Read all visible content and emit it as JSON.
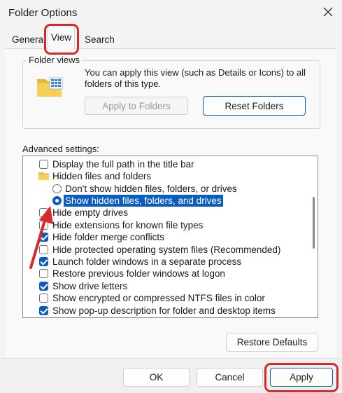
{
  "window": {
    "title": "Folder Options",
    "close_icon": "close-icon"
  },
  "tabs": [
    {
      "label": "General"
    },
    {
      "label": "View"
    },
    {
      "label": "Search"
    }
  ],
  "folder_views": {
    "group_label": "Folder views",
    "folder_icon": "folder-icon",
    "description_line1": "You can apply this view (such as Details or Icons) to all",
    "description_line2": "folders of this type.",
    "apply_to_folders_label": "Apply to Folders",
    "reset_folders_label": "Reset Folders"
  },
  "advanced": {
    "label": "Advanced settings:",
    "items": [
      {
        "label": "Display the full path in the title bar",
        "type": "checkbox",
        "checked": false
      },
      {
        "label": "Hidden files and folders",
        "type": "folder"
      },
      {
        "label": "Don't show hidden files, folders, or drives",
        "type": "radio",
        "checked": false
      },
      {
        "label": "Show hidden files, folders, and drives",
        "type": "radio",
        "checked": true
      },
      {
        "label": "Hide empty drives",
        "type": "checkbox",
        "checked": false
      },
      {
        "label": "Hide extensions for known file types",
        "type": "checkbox",
        "checked": false
      },
      {
        "label": "Hide folder merge conflicts",
        "type": "checkbox",
        "checked": true
      },
      {
        "label": "Hide protected operating system files (Recommended)",
        "type": "checkbox",
        "checked": false
      },
      {
        "label": "Launch folder windows in a separate process",
        "type": "checkbox",
        "checked": true
      },
      {
        "label": "Restore previous folder windows at logon",
        "type": "checkbox",
        "checked": false
      },
      {
        "label": "Show drive letters",
        "type": "checkbox",
        "checked": true
      },
      {
        "label": "Show encrypted or compressed NTFS files in color",
        "type": "checkbox",
        "checked": false
      },
      {
        "label": "Show pop-up description for folder and desktop items",
        "type": "checkbox",
        "checked": true
      }
    ]
  },
  "buttons": {
    "restore_defaults": "Restore Defaults",
    "ok": "OK",
    "cancel": "Cancel",
    "apply": "Apply"
  },
  "colors": {
    "accent": "#0b5cc2",
    "highlight": "#d62a2a"
  }
}
